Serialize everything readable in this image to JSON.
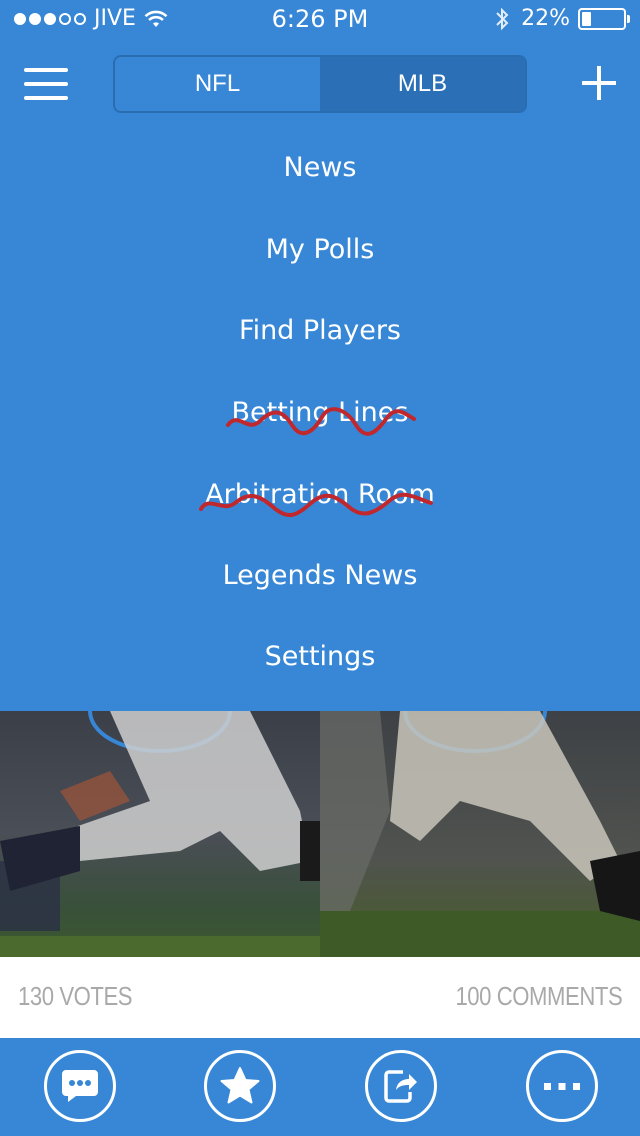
{
  "status_bar": {
    "carrier": "JIVE",
    "time": "6:26 PM",
    "battery_pct": "22%",
    "battery_level": 0.22,
    "signal_dots_filled": 3,
    "signal_dots_total": 5
  },
  "nav": {
    "segments": [
      {
        "label": "NFL",
        "selected": false
      },
      {
        "label": "MLB",
        "selected": true
      }
    ]
  },
  "menu": {
    "items": [
      {
        "label": "News",
        "struck": false
      },
      {
        "label": "My Polls",
        "struck": false
      },
      {
        "label": "Find Players",
        "struck": false
      },
      {
        "label": "Betting Lines",
        "struck": true
      },
      {
        "label": "Arbitration Room",
        "struck": true
      },
      {
        "label": "Legends News",
        "struck": false
      },
      {
        "label": "Settings",
        "struck": false
      }
    ]
  },
  "poll": {
    "votes": "130 VOTES",
    "comments": "100 COMMENTS"
  },
  "tab_bar": {
    "icons": [
      "chat-icon",
      "star-icon",
      "share-icon",
      "more-icon"
    ]
  },
  "colors": {
    "primary": "#3787d6",
    "segment_active": "#2b6fb6",
    "strike": "#c0282d",
    "meta_text": "#a9a9a9"
  }
}
